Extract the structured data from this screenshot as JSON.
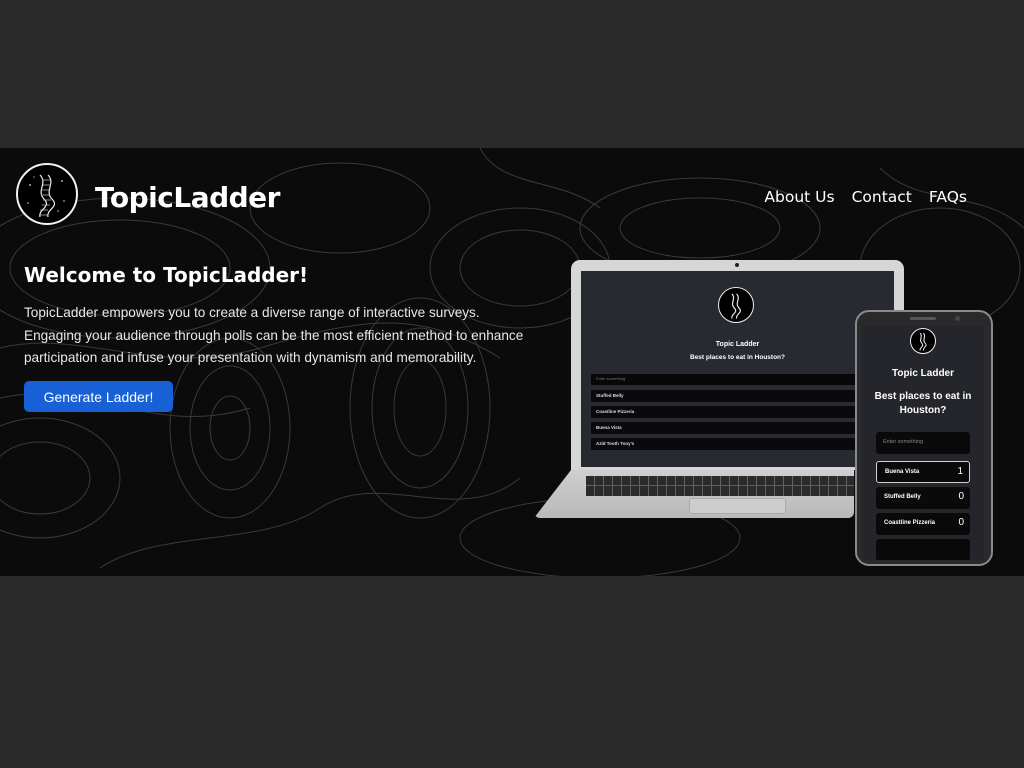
{
  "site": {
    "brand": "TopicLadder",
    "nav": [
      "About Us",
      "Contact",
      "FAQs"
    ]
  },
  "hero": {
    "heading": "Welcome to TopicLadder!",
    "description": "TopicLadder empowers you to create a diverse range of interactive surveys. Engaging your audience through polls can be the most efficient method to enhance participation and infuse your presentation with dynamism and memorability.",
    "cta_label": "Generate Ladder!"
  },
  "laptop_preview": {
    "title": "Topic Ladder",
    "question": "Best places to eat in Houston?",
    "input_placeholder": "Enter something",
    "items": [
      "Stuffed Belly",
      "Coastline Pizzeria",
      "Buena Vista",
      "Azld Tooth Tony's"
    ]
  },
  "phone_preview": {
    "title": "Topic Ladder",
    "question": "Best places to eat in Houston?",
    "input_placeholder": "Enter something",
    "items": [
      {
        "name": "Buena Vista",
        "count": "1"
      },
      {
        "name": "Stuffed Belly",
        "count": "0"
      },
      {
        "name": "Coastline Pizzeria",
        "count": "0"
      }
    ]
  },
  "colors": {
    "page_bg": "#2a2a2a",
    "hero_bg": "#0b0b0b",
    "cta_bg": "#1760d6",
    "text": "#ffffff"
  },
  "icons": [
    "ladder-logo-icon"
  ]
}
